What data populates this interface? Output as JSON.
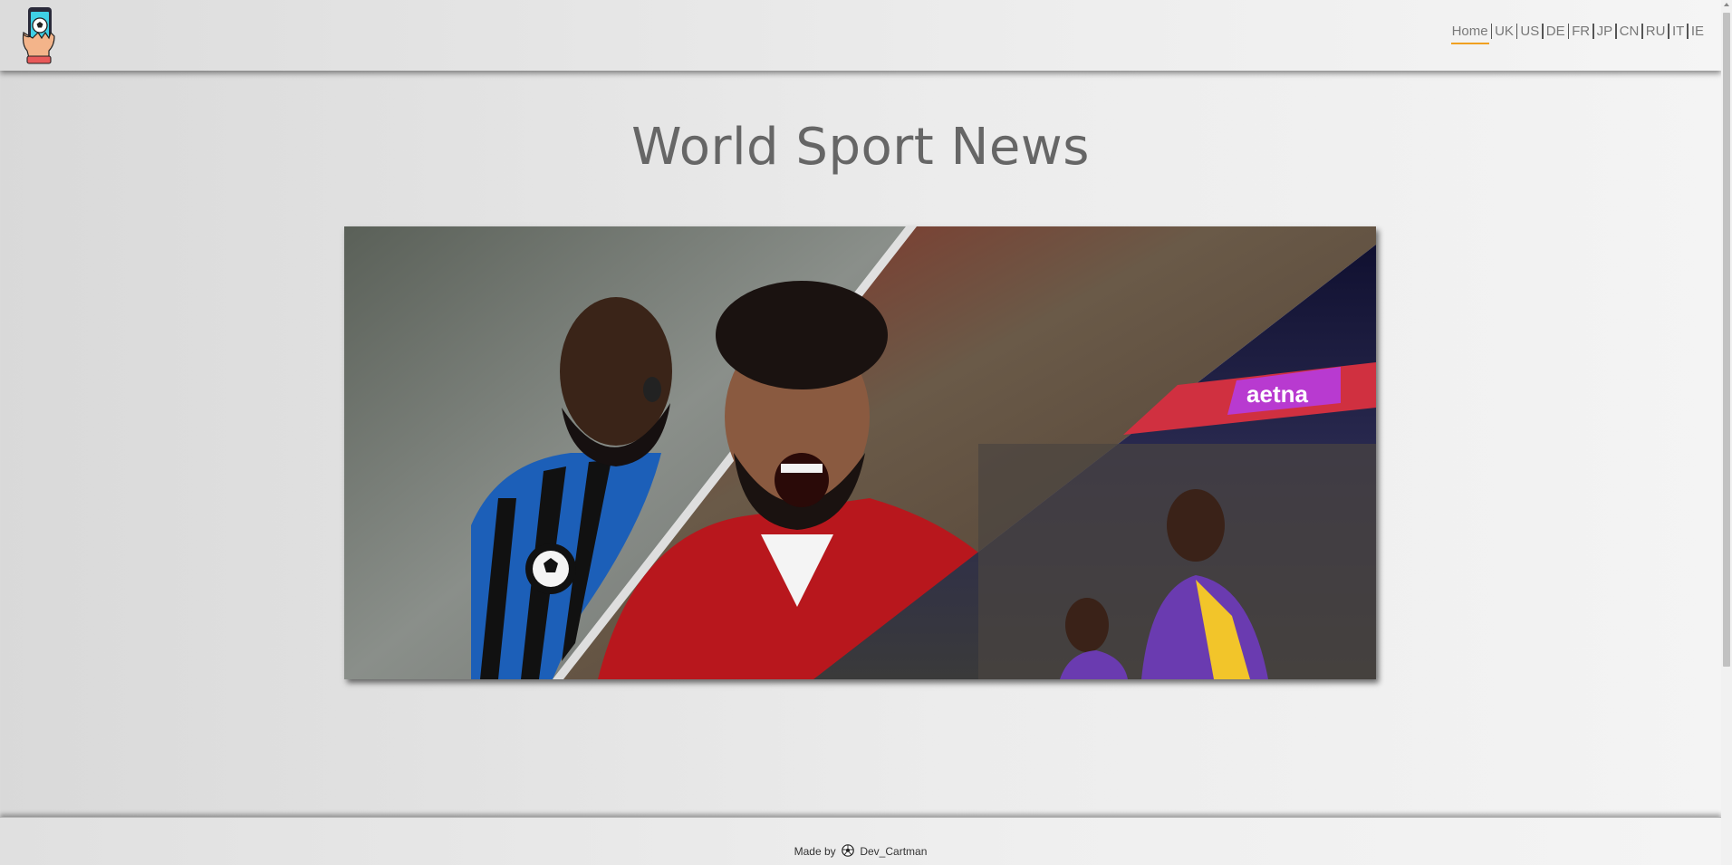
{
  "header": {
    "logo_icon": "phone-soccer-ball-icon",
    "nav": {
      "items": [
        {
          "label": "Home",
          "active": true
        },
        {
          "label": "UK"
        },
        {
          "label": "US"
        },
        {
          "label": "DE"
        },
        {
          "label": "FR"
        },
        {
          "label": "JP"
        },
        {
          "label": "CN"
        },
        {
          "label": "RU"
        },
        {
          "label": "IT"
        },
        {
          "label": "IE"
        }
      ],
      "active_underline_color": "#f0a020"
    }
  },
  "main": {
    "title": "World Sport News",
    "hero": {
      "panels": [
        "inter-footballer",
        "liverpool-footballer",
        "lakers-basketball"
      ],
      "banner_text": "aetna"
    }
  },
  "footer": {
    "made_by_label": "Made by",
    "author": "Dev_Cartman",
    "icon": "soccer-ball-icon"
  }
}
